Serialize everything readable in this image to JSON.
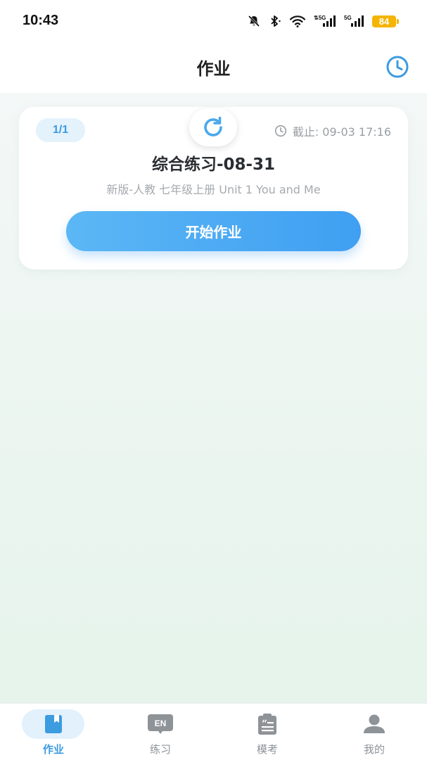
{
  "status_bar": {
    "time": "10:43",
    "battery": "84",
    "signal1": "5G",
    "signal2": "5G",
    "battery_color": "#f5b400"
  },
  "header": {
    "title": "作业",
    "history_icon": "clock-icon"
  },
  "homework_card": {
    "count": "1/1",
    "refresh_icon": "refresh-icon",
    "deadline": "截止: 09-03 17:16",
    "title": "综合练习-08-31",
    "subtitle": "新版-人教 七年级上册 Unit 1 You and Me",
    "start_label": "开始作业"
  },
  "bottom_nav": {
    "items": [
      {
        "label": "作业",
        "icon": "book-icon",
        "active": true
      },
      {
        "label": "练习",
        "icon": "en-chat-icon",
        "active": false
      },
      {
        "label": "模考",
        "icon": "quote-doc-icon",
        "active": false
      },
      {
        "label": "我的",
        "icon": "person-icon",
        "active": false
      }
    ]
  },
  "colors": {
    "accent": "#3d9be0",
    "button_gradient_start": "#5cb7f5",
    "button_gradient_end": "#3f9ff2",
    "inactive_nav": "#8e9398"
  }
}
